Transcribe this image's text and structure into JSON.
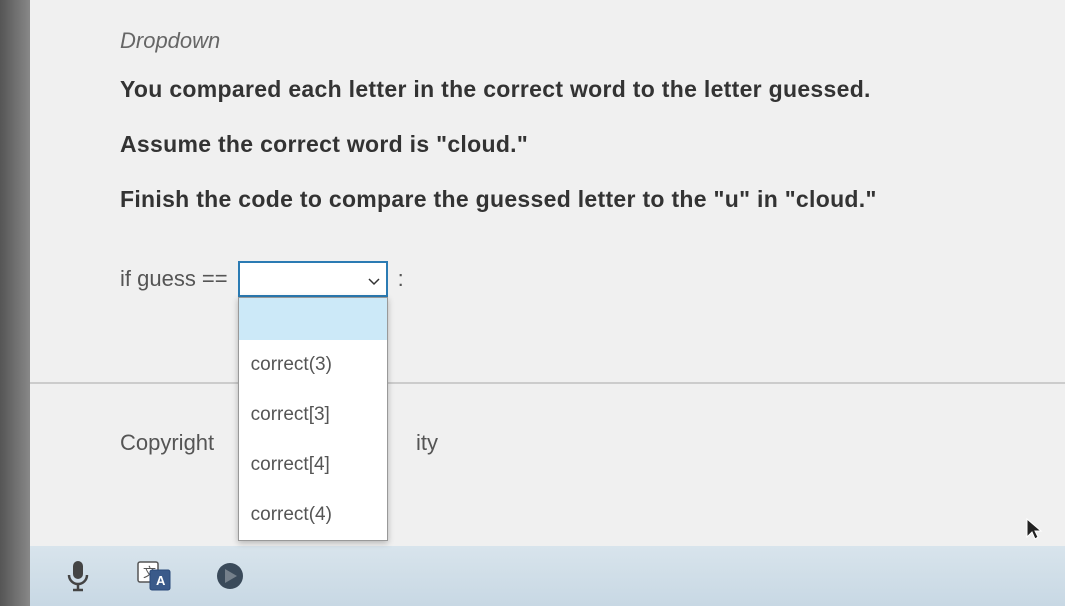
{
  "section_label": "Dropdown",
  "line1": "You compared each letter in the correct word to the letter guessed.",
  "line2": "Assume the correct word is \"cloud.\"",
  "line3": "Finish the code to compare the guessed letter to the \"u\" in \"cloud.\"",
  "code": {
    "prefix": "if guess ==",
    "suffix": ":"
  },
  "dropdown": {
    "selected": "",
    "options": [
      "",
      "correct(3)",
      "correct[3]",
      "correct[4]",
      "correct(4)"
    ]
  },
  "footer": {
    "copyright_prefix": "Copyright ",
    "visible_fragment": "ity"
  }
}
